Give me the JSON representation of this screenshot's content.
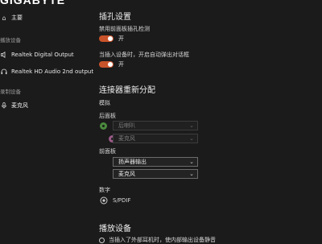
{
  "brand": "GIGABYTE",
  "sidebar": {
    "home_label": "主要",
    "playback_section": "播放设备",
    "playback_items": [
      {
        "label": "Realtek Digital Output",
        "icon": "speaker-icon"
      },
      {
        "label": "Realtek HD Audio 2nd output",
        "icon": "headphones-icon"
      }
    ],
    "recording_section": "录制设备",
    "recording_items": [
      {
        "label": "麦克风",
        "icon": "microphone-icon"
      }
    ]
  },
  "main": {
    "jack_settings_title": "插孔设置",
    "disable_front_detect_label": "禁用前面板插孔检测",
    "disable_front_detect_state": "开",
    "popup_on_insert_label": "当插入设备时，开启自动弹出对话框",
    "popup_on_insert_state": "开",
    "connector_title": "连接器重新分配",
    "analog_label": "模拟",
    "rear_panel_label": "后面板",
    "rear_dropdowns": [
      {
        "value": "后喇叭",
        "jack_color": "#4a8a3c",
        "disabled": true
      },
      {
        "value": "麦克风",
        "jack_color": "#9a5a86",
        "disabled": true
      }
    ],
    "front_panel_label": "前面板",
    "front_dropdowns": [
      {
        "value": "扬声器输出",
        "jack_color": "#7ad04a",
        "disabled": false
      },
      {
        "value": "麦克风",
        "jack_color": "#e48ad6",
        "disabled": false
      }
    ],
    "digital_label": "数字",
    "spdif_label": "S/PDIF",
    "playback_devices_title": "播放设备",
    "playback_option_label": "当插入了外部耳机时，使内部输出设备静音"
  },
  "colors": {
    "background": "#1b1b1b",
    "toggle_on": "#c8532a"
  }
}
